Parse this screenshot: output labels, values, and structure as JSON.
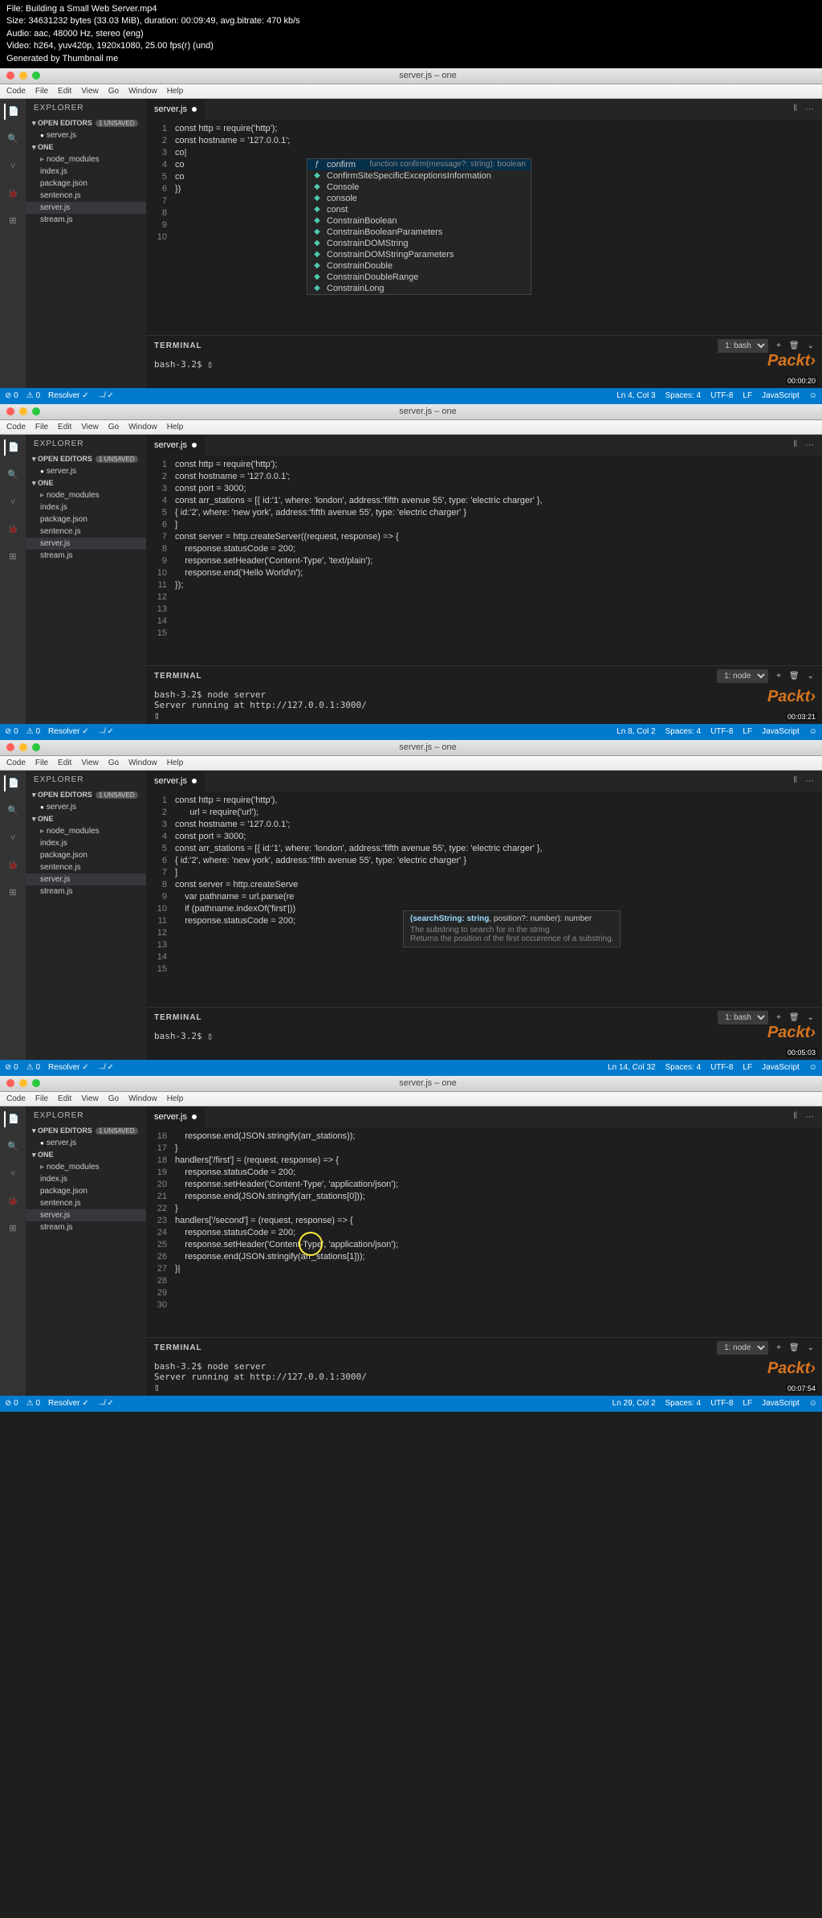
{
  "header": {
    "file": "File: Building a Small Web Server.mp4",
    "size": "Size: 34631232 bytes (33.03 MiB), duration: 00:09:49, avg.bitrate: 470 kb/s",
    "audio": "Audio: aac, 48000 Hz, stereo (eng)",
    "video": "Video: h264, yuv420p, 1920x1080, 25.00 fps(r) (und)",
    "generated": "Generated by Thumbnail me"
  },
  "mac": {
    "title": "server.js – one",
    "menu": [
      "Code",
      "File",
      "Edit",
      "View",
      "Go",
      "Window",
      "Help"
    ]
  },
  "explorer": {
    "title": "EXPLORER",
    "openEditors": "OPEN EDITORS",
    "unsaved": "1 UNSAVED",
    "project": "ONE",
    "files": [
      "node_modules",
      "index.js",
      "package.json",
      "sentence.js",
      "server.js",
      "stream.js"
    ],
    "openFile": "server.js"
  },
  "tab": "server.js",
  "watermark": "Packt›",
  "frame1": {
    "timecode": "00:00:20",
    "lines": [
      1,
      2,
      3,
      4,
      5,
      6,
      7,
      8,
      9,
      10
    ],
    "code": [
      {
        "t": "<kw>const</kw> <prop>http</prop> = <fn>require</fn>(<str>'http'</str>);"
      },
      {
        "t": ""
      },
      {
        "t": "<kw>const</kw> <prop>hostname</prop> = <str>'127.0.0.1'</str>;"
      },
      {
        "t": "co|"
      },
      {
        "t": "co"
      },
      {
        "t": "co"
      },
      {
        "t": ""
      },
      {
        "t": ""
      },
      {
        "t": ""
      },
      {
        "t": "})"
      }
    ],
    "autocomplete": {
      "selected": {
        "icon": "ƒ",
        "label": "confirm",
        "sig": "function confirm(message?: string): boolean"
      },
      "items": [
        {
          "icon": "◆",
          "label": "ConfirmSiteSpecificExceptionsInformation"
        },
        {
          "icon": "◆",
          "label": "Console"
        },
        {
          "icon": "◆",
          "label": "console"
        },
        {
          "icon": "◆",
          "label": "const"
        },
        {
          "icon": "◆",
          "label": "ConstrainBoolean"
        },
        {
          "icon": "◆",
          "label": "ConstrainBooleanParameters"
        },
        {
          "icon": "◆",
          "label": "ConstrainDOMString"
        },
        {
          "icon": "◆",
          "label": "ConstrainDOMStringParameters"
        },
        {
          "icon": "◆",
          "label": "ConstrainDouble"
        },
        {
          "icon": "◆",
          "label": "ConstrainDoubleRange"
        },
        {
          "icon": "◆",
          "label": "ConstrainLong"
        }
      ]
    },
    "terminal": {
      "shell": "1: bash",
      "prompt": "bash-3.2$ ▯"
    },
    "status": {
      "left": [
        "⊘ 0",
        "⚠ 0",
        "Resolver ✓",
        "↛ ✓"
      ],
      "right": [
        "Ln 4, Col 3",
        "Spaces: 4",
        "UTF-8",
        "LF",
        "JavaScript",
        "☺"
      ]
    }
  },
  "frame2": {
    "timecode": "00:03:21",
    "lines": [
      1,
      2,
      3,
      4,
      5,
      6,
      7,
      8,
      9,
      10,
      11,
      12,
      13,
      14,
      15
    ],
    "code": [
      "<kw>const</kw> <prop>http</prop> = <fn>require</fn>(<str>'http'</str>);",
      "",
      "<kw>const</kw> <prop>hostname</prop> = <str>'127.0.0.1'</str>;",
      "<kw>const</kw> <prop>port</prop> = <num>3000</num>;",
      "",
      "<kw>const</kw> <prop>arr_stations</prop> = [{ <prop>id</prop>:<str>'1'</str>, <prop>where</prop>: <str>'london'</str>, <prop>address</prop>:<str>'fifth avenue 55'</str>, <prop>type</prop>: <str>'electric charger'</str> },",
      "{ <prop>id</prop>:<str>'2'</str>, <prop>where</prop>: <str>'new york'</str>, <prop>address</prop>:<str>'fifth avenue 55'</str>, <prop>type</prop>: <str>'electric charger'</str> }",
      "]",
      "",
      "<kw>const</kw> <prop>server</prop> = <prop>http</prop>.<fn>createServer</fn>((<prop>request</prop>, <prop>response</prop>) <kw>=></kw> {",
      "    <prop>response</prop>.<prop>statusCode</prop> = <num>200</num>;",
      "    <prop>response</prop>.<fn>setHeader</fn>(<str>'Content-Type'</str>, <str>'text/plain'</str>);",
      "    <prop>response</prop>.<fn>end</fn>(<str>'Hello World\\n'</str>);",
      "});",
      ""
    ],
    "terminal": {
      "shell": "1: node",
      "body": "bash-3.2$ node server\nServer running at http://127.0.0.1:3000/\n▯"
    },
    "status": {
      "left": [
        "⊘ 0",
        "⚠ 0",
        "Resolver ✓",
        "↛ ✓"
      ],
      "right": [
        "Ln 8, Col 2",
        "Spaces: 4",
        "UTF-8",
        "LF",
        "JavaScript",
        "☺"
      ]
    }
  },
  "frame3": {
    "timecode": "00:05:03",
    "lines": [
      1,
      2,
      3,
      4,
      5,
      6,
      7,
      8,
      9,
      10,
      11,
      12,
      13,
      14,
      15
    ],
    "code": [
      "<kw>const</kw> <prop>http</prop> = <fn>require</fn>(<str>'http'</str>),",
      "      <prop>url</prop> = <fn>require</fn>(<str>'url'</str>);",
      "",
      "<kw>const</kw> <prop>hostname</prop> = <str>'127.0.0.1'</str>;",
      "<kw>const</kw> <prop>port</prop> = <num>3000</num>;",
      "",
      "<kw>const</kw> <prop>arr_stations</prop> = [{ <prop>id</prop>:<str>'1'</str>, <prop>where</prop>: <str>'london'</str>, <prop>address</prop>:<str>'fifth avenue 55'</str>, <prop>type</prop>: <str>'electric charger'</str> },",
      "{ <prop>id</prop>:<str>'2'</str>, <prop>where</prop>: <str>'new york'</str>, <prop>address</prop>:<str>'fifth avenue 55'</str>, <prop>type</prop>: <str>'electric charger'</str> }",
      "]",
      "",
      "<kw>const</kw> <prop>server</prop> = <prop>http</prop>.<fn>createServe</fn>",
      "    <kw>var</kw> <prop>pathname</prop> = <prop>url</prop>.<fn>parse</fn>(<prop>re</prop>",
      "",
      "    <kw>if</kw> (<prop>pathname</prop>.<fn>indexOf</fn>(<str>'first'</str>|))",
      "    <prop>response</prop>.<prop>statusCode</prop> = <num>200</num>;"
    ],
    "sigtip": {
      "sig": "(searchString: string, position?: number): number",
      "desc1": "The substring to search for in the string",
      "desc2": "Returns the position of the first occurrence of a substring."
    },
    "terminal": {
      "shell": "1: bash",
      "body": "bash-3.2$ ▯"
    },
    "status": {
      "left": [
        "⊘ 0",
        "⚠ 0",
        "Resolver ✓",
        "↛ ✓"
      ],
      "right": [
        "Ln 14, Col 32",
        "Spaces: 4",
        "UTF-8",
        "LF",
        "JavaScript",
        "☺"
      ]
    }
  },
  "frame4": {
    "timecode": "00:07:54",
    "lines": [
      16,
      17,
      18,
      19,
      20,
      21,
      22,
      23,
      24,
      25,
      26,
      27,
      28,
      29,
      30
    ],
    "code": [
      "    <prop>response</prop>.<fn>end</fn>(<prop>JSON</prop>.<fn>stringify</fn>(<prop>arr_stations</prop>));",
      "}",
      "",
      "<prop>handlers</prop>[<str>'/first'</str>] = (<prop>request</prop>, <prop>response</prop>) <kw>=></kw> {",
      "    <prop>response</prop>.<prop>statusCode</prop> = <num>200</num>;",
      "    <prop>response</prop>.<fn>setHeader</fn>(<str>'Content-Type'</str>, <str>'application/json'</str>);",
      "    <prop>response</prop>.<fn>end</fn>(<prop>JSON</prop>.<fn>stringify</fn>(<prop>arr_stations</prop>[<num>0</num>]));",
      "}",
      "",
      "<prop>handlers</prop>[<str>'/second'</str>] = (<prop>request</prop>, <prop>response</prop>) <kw>=></kw> {",
      "    <prop>response</prop>.<prop>statusCode</prop> = <num>200</num>;",
      "    <prop>response</prop>.<fn>setHeader</fn>(<str>'Content-Type'</str>, <str>'application/json'</str>);",
      "    <prop>response</prop>.<fn>end</fn>(<prop>JSON</prop>.<fn>stringify</fn>(<prop>arr_stations</prop>[<num>1</num>]));",
      "}|",
      ""
    ],
    "terminal": {
      "shell": "1: node",
      "body": "bash-3.2$ node server\nServer running at http://127.0.0.1:3000/\n▯"
    },
    "status": {
      "left": [
        "⊘ 0",
        "⚠ 0",
        "Resolver ✓",
        "↛ ✓"
      ],
      "right": [
        "Ln 29, Col 2",
        "Spaces: 4",
        "UTF-8",
        "LF",
        "JavaScript",
        "☺"
      ]
    }
  }
}
